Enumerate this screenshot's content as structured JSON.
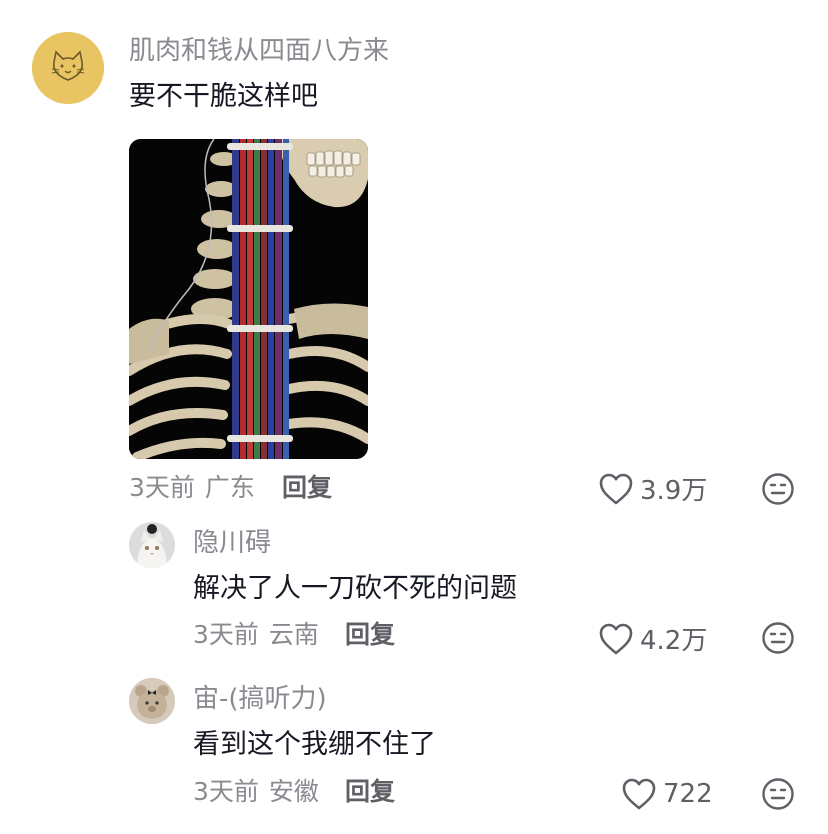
{
  "comments": [
    {
      "username": "肌肉和钱从四面八方来",
      "text": "要不干脆这样吧",
      "time": "3天前",
      "location": "广东",
      "reply_label": "回复",
      "likes": "3.9万",
      "avatar_icon": "cat-doodle-avatar"
    },
    {
      "username": "隐川碍",
      "text": "解决了人一刀砍不死的问题",
      "time": "3天前",
      "location": "云南",
      "reply_label": "回复",
      "likes": "4.2万",
      "avatar_icon": "white-cat-avatar"
    },
    {
      "username": "宙-(搞听力)",
      "text": "看到这个我绷不住了",
      "time": "3天前",
      "location": "安徽",
      "reply_label": "回复",
      "likes": "722",
      "avatar_icon": "plush-bear-avatar"
    }
  ],
  "colors": {
    "secondary_text": "#8a8b91",
    "primary_text": "#161823",
    "action_text": "#5f6066",
    "background": "#ffffff"
  }
}
